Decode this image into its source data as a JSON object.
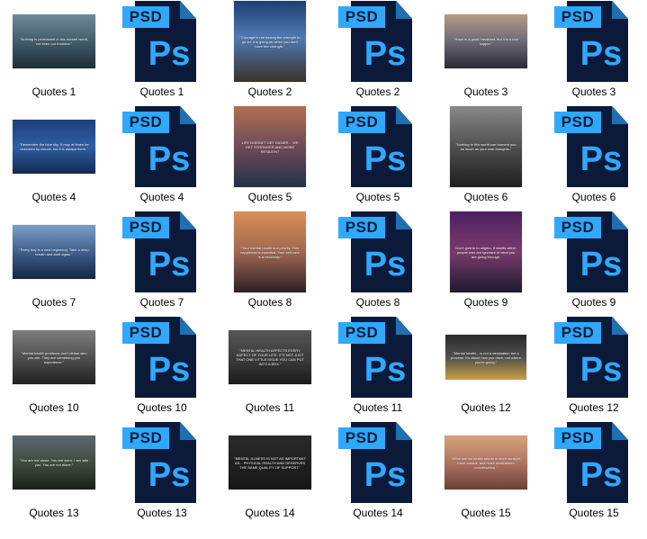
{
  "window": {
    "title": ""
  },
  "items": [
    {
      "label": "Quotes 1",
      "type": "image",
      "caption": "\"Nothing is permanent in this wicked world, not even our troubles.\""
    },
    {
      "label": "Quotes 1",
      "type": "psd",
      "badge": "PSD",
      "glyph": "Ps"
    },
    {
      "label": "Quotes 2",
      "type": "image",
      "caption": "\"Courage is not having the strength to go on; it is going on when you don't have the strength.\""
    },
    {
      "label": "Quotes 2",
      "type": "psd",
      "badge": "PSD",
      "glyph": "Ps"
    },
    {
      "label": "Quotes 3",
      "type": "image",
      "caption": "\"Hope is a good breakfast, but it is a bad supper.\""
    },
    {
      "label": "Quotes 3",
      "type": "psd",
      "badge": "PSD",
      "glyph": "Ps"
    },
    {
      "label": "Quotes 4",
      "type": "image",
      "caption": "\"Remember the blue sky. It may at times be obscured by clouds, but it is always there.\""
    },
    {
      "label": "Quotes 4",
      "type": "psd",
      "badge": "PSD",
      "glyph": "Ps"
    },
    {
      "label": "Quotes 5",
      "type": "image",
      "caption": "LIFE DOESN'T GET EASIER... WE GET STRONGER AND MORE RESILIENT"
    },
    {
      "label": "Quotes 5",
      "type": "psd",
      "badge": "PSD",
      "glyph": "Ps"
    },
    {
      "label": "Quotes 6",
      "type": "image",
      "caption": "\"Nothing in this world can torment you as much as your own thoughts.\""
    },
    {
      "label": "Quotes 6",
      "type": "psd",
      "badge": "PSD",
      "glyph": "Ps"
    },
    {
      "label": "Quotes 7",
      "type": "image",
      "caption": "\"Every day is a new beginning. Take a deep breath and start again.\""
    },
    {
      "label": "Quotes 7",
      "type": "psd",
      "badge": "PSD",
      "glyph": "Ps"
    },
    {
      "label": "Quotes 8",
      "type": "image",
      "caption": "\"Your mental health is a priority. Your happiness is essential. Your self care is a necessity.\""
    },
    {
      "label": "Quotes 8",
      "type": "psd",
      "badge": "PSD",
      "glyph": "Ps"
    },
    {
      "label": "Quotes 9",
      "type": "image",
      "caption": "Don't give in to stigma. It dwells within people who are ignorant of what you are going through."
    },
    {
      "label": "Quotes 9",
      "type": "psd",
      "badge": "PSD",
      "glyph": "Ps"
    },
    {
      "label": "Quotes 10",
      "type": "image",
      "caption": "\"Mental health problems don't define who you are. They are something you experience.\""
    },
    {
      "label": "Quotes 10",
      "type": "psd",
      "badge": "PSD",
      "glyph": "Ps"
    },
    {
      "label": "Quotes 11",
      "type": "image",
      "caption": "\"MENTAL HEALTH AFFECTS EVERY ASPECT OF YOUR LIFE. IT'S NOT JUST THAT ONE LITTLE ISSUE YOU CAN PUT INTO A BOX.\""
    },
    {
      "label": "Quotes 11",
      "type": "psd",
      "badge": "PSD",
      "glyph": "Ps"
    },
    {
      "label": "Quotes 12",
      "type": "image",
      "caption": "\"Mental health... is not a destination but a process. It's about how you drive, not where you're going.\""
    },
    {
      "label": "Quotes 12",
      "type": "psd",
      "badge": "PSD",
      "glyph": "Ps"
    },
    {
      "label": "Quotes 13",
      "type": "image",
      "caption": "\"You are not alone. You are seen. I am with you. You are not alone.\""
    },
    {
      "label": "Quotes 13",
      "type": "psd",
      "badge": "PSD",
      "glyph": "Ps"
    },
    {
      "label": "Quotes 14",
      "type": "image",
      "caption": "\"MENTAL ILLNESS IS NOT AS IMPORTANT AS... PHYSICAL HEALTH AND DESERVES THE SAME QUALITY OF SUPPORT.\""
    },
    {
      "label": "Quotes 14",
      "type": "psd",
      "badge": "PSD",
      "glyph": "Ps"
    },
    {
      "label": "Quotes 15",
      "type": "image",
      "caption": "\"What mental health needs is more sunlight, more candor, and more unashamed conversation.\""
    },
    {
      "label": "Quotes 15",
      "type": "psd",
      "badge": "PSD",
      "glyph": "Ps"
    }
  ],
  "colors": {
    "psd_badge": "#31a8ff",
    "psd_body": "#0c1a3a",
    "ps_glyph": "#31a8ff"
  }
}
